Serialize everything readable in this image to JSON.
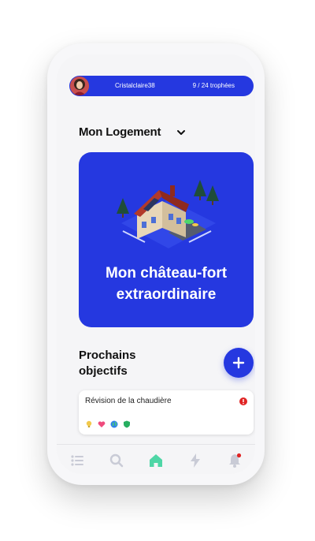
{
  "profile": {
    "username": "Cristalclaire38",
    "trophies": "9 / 24  trophées"
  },
  "home": {
    "section_title": "Mon Logement"
  },
  "hero": {
    "title": "Mon château-fort\nextraordinaire"
  },
  "goals": {
    "title": "Prochains\nobjectifs",
    "items": [
      {
        "label": "Révision de la chaudière"
      }
    ]
  },
  "tabs": [
    "list-icon",
    "search-icon",
    "home-icon",
    "energy-icon",
    "notifications-icon"
  ],
  "colors": {
    "primary": "#2538e0",
    "active_tab": "#4fd6a6",
    "alert": "#e02424"
  }
}
